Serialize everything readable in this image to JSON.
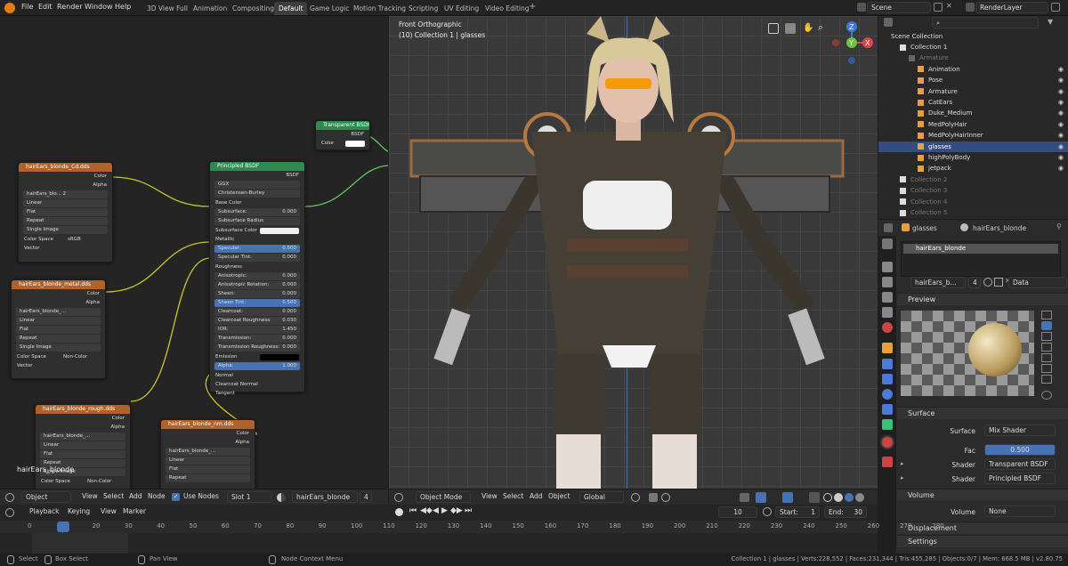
{
  "menu": {
    "items": [
      "File",
      "Edit",
      "Render",
      "Window",
      "Help"
    ]
  },
  "workspaces": [
    "3D View Full",
    "Animation",
    "Compositing",
    "Default",
    "Game Logic",
    "Motion Tracking",
    "Scripting",
    "UV Editing",
    "Video Editing"
  ],
  "active_workspace": "Default",
  "topright": {
    "scene": "Scene",
    "renderlayer": "RenderLayer"
  },
  "viewport": {
    "view_name": "Front Orthographic",
    "object_info": "(10) Collection 1 | glasses",
    "mode": "Object Mode",
    "menus": [
      "View",
      "Select",
      "Add",
      "Object"
    ],
    "orientation": "Global"
  },
  "nodes": {
    "transparent": {
      "title": "Transparent BSDF",
      "out": "BSDF",
      "color": "Color"
    },
    "principled": {
      "title": "Principled BSDF",
      "out": "BSDF",
      "dist": "GGX",
      "sss": "Christensen-Burley",
      "rows": [
        {
          "l": "Base Color",
          "v": "",
          "t": "sock"
        },
        {
          "l": "Subsurface:",
          "v": "0.000",
          "t": "f"
        },
        {
          "l": "Subsurface Radius",
          "v": "",
          "t": "drop"
        },
        {
          "l": "Subsurface Color",
          "v": "",
          "t": "white"
        },
        {
          "l": "Metallic",
          "v": "",
          "t": "sock"
        },
        {
          "l": "Specular:",
          "v": "0.500",
          "t": "blue"
        },
        {
          "l": "Specular Tint:",
          "v": "0.000",
          "t": "f"
        },
        {
          "l": "Roughness",
          "v": "",
          "t": "sock"
        },
        {
          "l": "Anisotropic:",
          "v": "0.000",
          "t": "f"
        },
        {
          "l": "Anisotropic Rotation:",
          "v": "0.000",
          "t": "f"
        },
        {
          "l": "Sheen:",
          "v": "0.000",
          "t": "f"
        },
        {
          "l": "Sheen Tint:",
          "v": "0.500",
          "t": "blue"
        },
        {
          "l": "Clearcoat:",
          "v": "0.000",
          "t": "f"
        },
        {
          "l": "Clearcoat Roughness:",
          "v": "0.030",
          "t": "f"
        },
        {
          "l": "IOR:",
          "v": "1.450",
          "t": "f"
        },
        {
          "l": "Transmission:",
          "v": "0.000",
          "t": "f"
        },
        {
          "l": "Transmission Roughness:",
          "v": "0.000",
          "t": "f"
        },
        {
          "l": "Emission",
          "v": "",
          "t": "black"
        },
        {
          "l": "Alpha:",
          "v": "1.000",
          "t": "blue"
        },
        {
          "l": "Normal",
          "v": "",
          "t": "sock"
        },
        {
          "l": "Clearcoat Normal",
          "v": "",
          "t": "sock"
        },
        {
          "l": "Tangent",
          "v": "",
          "t": "sock"
        }
      ]
    },
    "tex1": {
      "title": "hairEars_blonde_Cd.dds",
      "img": "hairEars_blo...",
      "users": "2",
      "interp": "Linear",
      "proj": "Flat",
      "ext": "Repeat",
      "src": "Single Image",
      "cs_label": "Color Space",
      "cs": "sRGB",
      "vector": "Vector",
      "color": "Color",
      "alpha": "Alpha"
    },
    "tex2": {
      "title": "hairEars_blonde_metal.dds",
      "img": "hairEars_blonde_...",
      "interp": "Linear",
      "proj": "Flat",
      "ext": "Repeat",
      "src": "Single Image",
      "cs_label": "Color Space",
      "cs": "Non-Color",
      "vector": "Vector",
      "color": "Color",
      "alpha": "Alpha"
    },
    "tex3": {
      "title": "hairEars_blonde_rough.dds",
      "img": "hairEars_blonde_...",
      "interp": "Linear",
      "proj": "Flat",
      "ext": "Repeat",
      "src": "Single Image",
      "cs_label": "Color Space",
      "cs": "Non-Color",
      "color": "Color",
      "alpha": "Alpha"
    },
    "tex4": {
      "title": "hairEars_blonde_nm.dds",
      "img": "hairEars_blonde_...",
      "interp": "Linear",
      "proj": "Flat",
      "ext": "Repeat",
      "src": "Single Image",
      "color": "Color",
      "alpha": "Alpha"
    }
  },
  "node_material_label": "hairEars_blonde",
  "node_header": {
    "mode": "Object",
    "menus": [
      "View",
      "Select",
      "Add",
      "Node"
    ],
    "use_nodes": "Use Nodes",
    "slot": "Slot 1",
    "material": "hairEars_blonde",
    "users": "4"
  },
  "outliner": {
    "root": "Scene Collection",
    "rows": [
      {
        "name": "Collection 1",
        "indent": 1,
        "dim": false,
        "sel": false
      },
      {
        "name": "Armature",
        "indent": 2,
        "dim": true,
        "sel": false
      },
      {
        "name": "Animation",
        "indent": 3,
        "dim": false,
        "sel": false
      },
      {
        "name": "Pose",
        "indent": 3,
        "dim": false,
        "sel": false
      },
      {
        "name": "Armature",
        "indent": 3,
        "dim": false,
        "sel": false
      },
      {
        "name": "CatEars",
        "indent": 3,
        "dim": false,
        "sel": false
      },
      {
        "name": "Duke_Medium",
        "indent": 3,
        "dim": false,
        "sel": false
      },
      {
        "name": "MedPolyHair",
        "indent": 3,
        "dim": false,
        "sel": false
      },
      {
        "name": "MedPolyHairInner",
        "indent": 3,
        "dim": false,
        "sel": false
      },
      {
        "name": "glasses",
        "indent": 3,
        "dim": false,
        "sel": true
      },
      {
        "name": "highPolyBody",
        "indent": 3,
        "dim": false,
        "sel": false
      },
      {
        "name": "jetpack",
        "indent": 3,
        "dim": false,
        "sel": false
      },
      {
        "name": "Collection 2",
        "indent": 1,
        "dim": true,
        "sel": false
      },
      {
        "name": "Collection 3",
        "indent": 1,
        "dim": true,
        "sel": false
      },
      {
        "name": "Collection 4",
        "indent": 1,
        "dim": true,
        "sel": false
      },
      {
        "name": "Collection 5",
        "indent": 1,
        "dim": true,
        "sel": false
      }
    ]
  },
  "properties": {
    "breadcrumb_obj": "glasses",
    "breadcrumb_mat": "hairEars_blonde",
    "slot_item": "hairEars_blonde",
    "mat_name": "hairEars_b...",
    "mat_users": "4",
    "link": "Data",
    "preview": "Preview",
    "surface": "Surface",
    "surface_label": "Surface",
    "surface_value": "Mix Shader",
    "fac_label": "Fac",
    "fac_value": "0.500",
    "shader1_label": "Shader",
    "shader1_value": "Transparent BSDF",
    "shader2_label": "Shader",
    "shader2_value": "Principled BSDF",
    "volume": "Volume",
    "volume_label": "Volume",
    "volume_value": "None",
    "displacement": "Displacement",
    "settings": "Settings"
  },
  "timeline": {
    "menus": [
      "Playback",
      "Keying",
      "View",
      "Marker"
    ],
    "current": "10",
    "start_label": "Start:",
    "start": "1",
    "end_label": "End:",
    "end": "30",
    "ticks": [
      "0",
      "10",
      "20",
      "30",
      "40",
      "50",
      "60",
      "70",
      "80",
      "90",
      "100",
      "110",
      "120",
      "130",
      "140",
      "150",
      "160",
      "170",
      "180",
      "190",
      "200",
      "210",
      "220",
      "230",
      "240",
      "250",
      "260",
      "270",
      "280"
    ]
  },
  "status": {
    "select": "Select",
    "box_select": "Box Select",
    "pan": "Pan View",
    "context": "Node Context Menu",
    "info": "Collection 1 | glasses | Verts:228,552 | Faces:231,344 | Tris:455,285 | Objects:0/7 | Mem: 668.5 MB | v2.80.75"
  }
}
